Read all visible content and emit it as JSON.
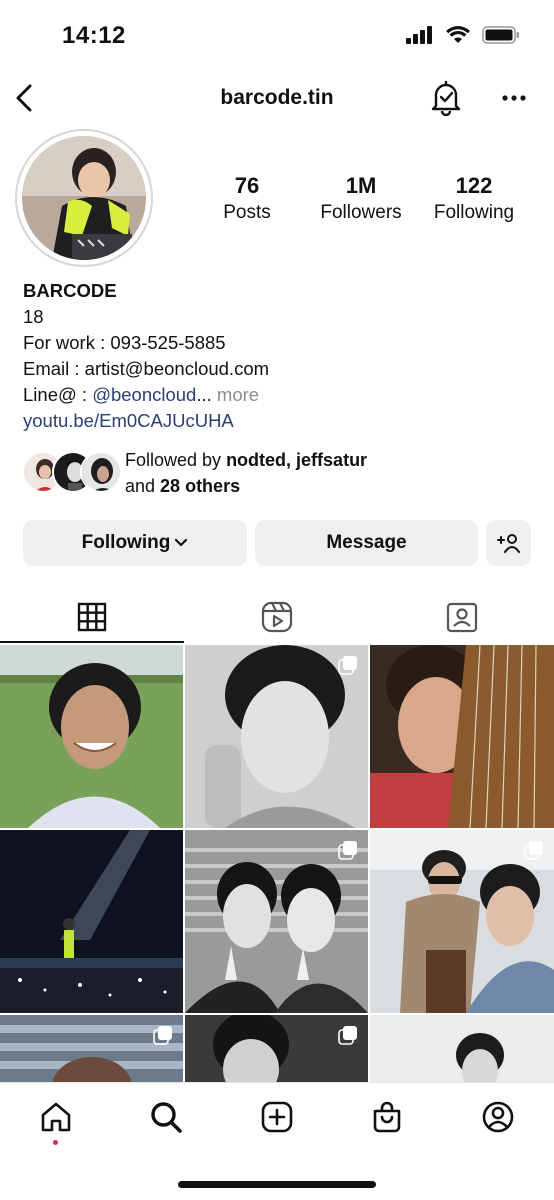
{
  "status_bar": {
    "time": "14:12"
  },
  "header": {
    "username": "barcode.tin"
  },
  "stats": [
    {
      "value": "76",
      "label": "Posts"
    },
    {
      "value": "1M",
      "label": "Followers"
    },
    {
      "value": "122",
      "label": "Following"
    }
  ],
  "bio": {
    "name": "BARCODE",
    "lines": [
      "18",
      "For work : 093-525-5885",
      "Email : artist@beoncloud.com"
    ],
    "line_prefix": "Line@ : ",
    "line_mention": "@beoncloud",
    "line_ellipsis": "...",
    "more": " more",
    "link": "youtu.be/Em0CAJUcUHA"
  },
  "followed_by": {
    "prefix": "Followed by ",
    "names": "nodted, jeffsatur",
    "and": "and ",
    "others": "28 others"
  },
  "buttons": {
    "following": "Following",
    "message": "Message"
  },
  "tabs": [
    "grid-icon",
    "reels-icon",
    "tagged-icon"
  ],
  "bottom_nav": [
    "home-icon",
    "search-icon",
    "create-icon",
    "shop-icon",
    "profile-icon"
  ],
  "colors": {
    "link": "#2b3f72",
    "button_bg": "#efefef",
    "notification_dot": "#e0245e"
  }
}
